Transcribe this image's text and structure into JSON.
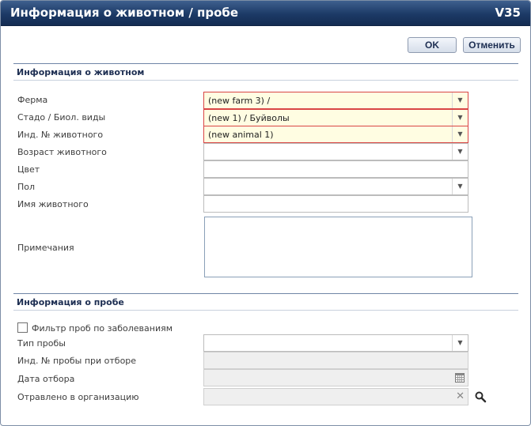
{
  "dialog": {
    "title": "Информация о животном / пробе",
    "version": "V35"
  },
  "buttons": {
    "ok": "OK",
    "cancel": "Отменить"
  },
  "animal_section": {
    "title": "Информация о животном",
    "farm": {
      "label": "Ферма",
      "value": "(new farm 3) /"
    },
    "herd": {
      "label": "Стадо / Биол. виды",
      "value": "(new 1) / Буйволы"
    },
    "animal_id": {
      "label": "Инд. № животного",
      "value": "(new animal 1)"
    },
    "age": {
      "label": "Возраст животного",
      "value": ""
    },
    "color": {
      "label": "Цвет",
      "value": ""
    },
    "sex": {
      "label": "Пол",
      "value": ""
    },
    "name": {
      "label": "Имя животного",
      "value": ""
    },
    "notes": {
      "label": "Примечания",
      "value": ""
    }
  },
  "sample_section": {
    "title": "Информация о пробе",
    "filter": {
      "label": "Фильтр проб по заболеваниям",
      "checked": false
    },
    "sample_type": {
      "label": "Тип пробы",
      "value": ""
    },
    "field_sample_id": {
      "label": "Инд. № пробы при отборе",
      "value": ""
    },
    "collection_date": {
      "label": "Дата отбора",
      "value": ""
    },
    "sent_to": {
      "label": "Отравлено в организацию",
      "value": ""
    }
  },
  "icons": {
    "dropdown": "chevron-down-icon",
    "calendar": "calendar-icon",
    "clear": "clear-icon",
    "search": "search-icon"
  },
  "colors": {
    "titlebar": "#1c3a66",
    "required_border": "#d94545",
    "required_fill": "#fffde2",
    "section_text": "#1d2e52"
  }
}
